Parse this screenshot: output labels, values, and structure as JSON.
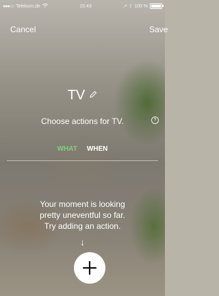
{
  "status_bar": {
    "carrier": "Telekom.de",
    "time": "15:43",
    "battery": "100 %",
    "signal_icon": "signal-dots-icon",
    "wifi_icon": "wifi-icon"
  },
  "nav": {
    "cancel_label": "Cancel",
    "save_label": "Save"
  },
  "header": {
    "title": "TV",
    "edit_icon": "pencil-icon",
    "subtitle": "Choose actions for TV.",
    "help_icon": "help-circle-icon",
    "help_glyph": "?"
  },
  "tabs": [
    {
      "label": "WHAT",
      "active": true,
      "color": "#7ed27a"
    },
    {
      "label": "WHEN",
      "active": false,
      "color": "#ffffff"
    }
  ],
  "empty_state": {
    "line1": "Your moment is looking",
    "line2": "pretty uneventful so far.",
    "line3": "Try adding an action.",
    "arrow": "↓"
  },
  "add_button": {
    "icon": "plus-icon"
  }
}
